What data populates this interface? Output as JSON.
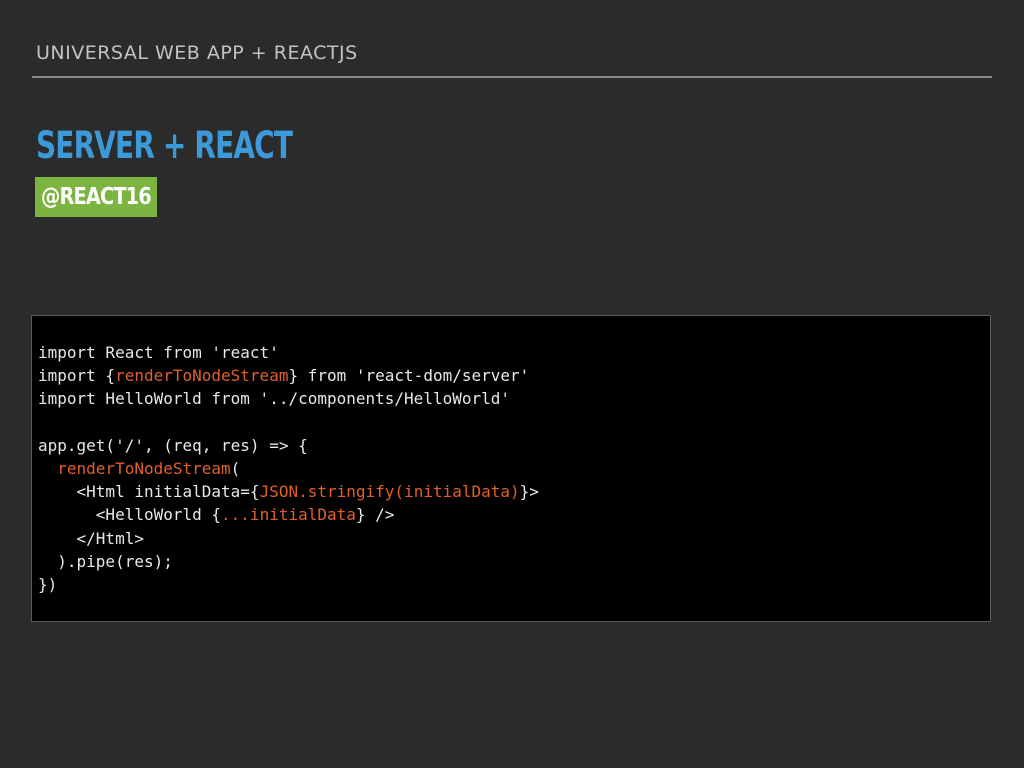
{
  "header": {
    "title": "UNIVERSAL WEB APP + REACTJS"
  },
  "slide": {
    "title": "SERVER + REACT",
    "badge": "@REACT16",
    "colors": {
      "background": "#2b2b2b",
      "title": "#3d9ad9",
      "badge_bg": "#7cb442",
      "code_bg": "#000000",
      "code_text": "#e8e8e8",
      "code_highlight": "#e0602a"
    }
  },
  "code": {
    "lines": [
      [
        {
          "text": "import React from 'react'",
          "hl": false
        }
      ],
      [
        {
          "text": "import {",
          "hl": false
        },
        {
          "text": "renderToNodeStream",
          "hl": true
        },
        {
          "text": "} from 'react-dom/server'",
          "hl": false
        }
      ],
      [
        {
          "text": "import HelloWorld from '../components/HelloWorld'",
          "hl": false
        }
      ],
      [
        {
          "text": "",
          "hl": false
        }
      ],
      [
        {
          "text": "app.get('/', (req, res) => {",
          "hl": false
        }
      ],
      [
        {
          "text": "  ",
          "hl": false
        },
        {
          "text": "renderToNodeStream",
          "hl": true
        },
        {
          "text": "(",
          "hl": false
        }
      ],
      [
        {
          "text": "    <Html initialData={",
          "hl": false
        },
        {
          "text": "JSON.stringify(initialData)",
          "hl": true
        },
        {
          "text": "}>",
          "hl": false
        }
      ],
      [
        {
          "text": "      <HelloWorld {",
          "hl": false
        },
        {
          "text": "...initialData",
          "hl": true
        },
        {
          "text": "} />",
          "hl": false
        }
      ],
      [
        {
          "text": "    </Html>",
          "hl": false
        }
      ],
      [
        {
          "text": "  ).pipe(res);",
          "hl": false
        }
      ],
      [
        {
          "text": "})",
          "hl": false
        }
      ]
    ]
  }
}
